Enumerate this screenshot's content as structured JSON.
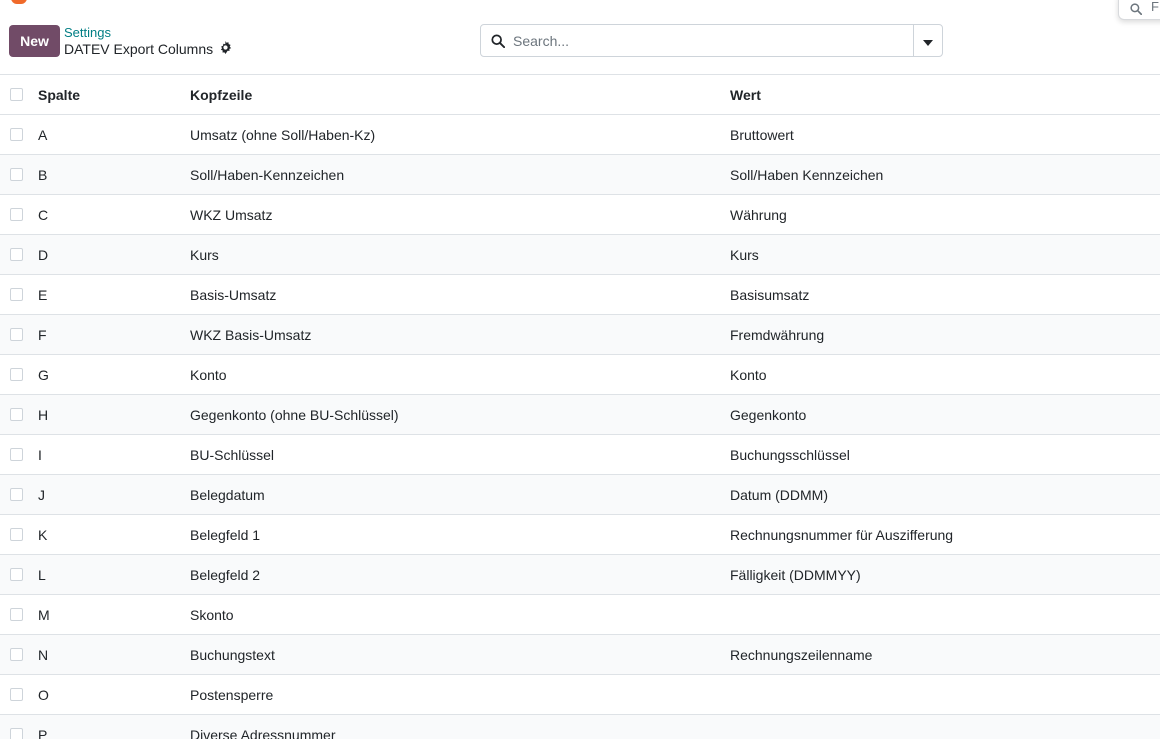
{
  "popover": {
    "text": "F"
  },
  "control_panel": {
    "new_label": "New",
    "breadcrumb_parent": "Settings",
    "breadcrumb_current": "DATEV Export Columns",
    "search_placeholder": "Search..."
  },
  "table": {
    "headers": {
      "spalte": "Spalte",
      "kopfzeile": "Kopfzeile",
      "wert": "Wert"
    },
    "rows": [
      {
        "spalte": "A",
        "kopfzeile": "Umsatz (ohne Soll/Haben-Kz)",
        "wert": "Bruttowert"
      },
      {
        "spalte": "B",
        "kopfzeile": "Soll/Haben-Kennzeichen",
        "wert": "Soll/Haben Kennzeichen"
      },
      {
        "spalte": "C",
        "kopfzeile": "WKZ Umsatz",
        "wert": "Währung"
      },
      {
        "spalte": "D",
        "kopfzeile": "Kurs",
        "wert": "Kurs"
      },
      {
        "spalte": "E",
        "kopfzeile": "Basis-Umsatz",
        "wert": "Basisumsatz"
      },
      {
        "spalte": "F",
        "kopfzeile": "WKZ Basis-Umsatz",
        "wert": "Fremdwährung"
      },
      {
        "spalte": "G",
        "kopfzeile": "Konto",
        "wert": "Konto"
      },
      {
        "spalte": "H",
        "kopfzeile": "Gegenkonto (ohne BU-Schlüssel)",
        "wert": "Gegenkonto"
      },
      {
        "spalte": "I",
        "kopfzeile": "BU-Schlüssel",
        "wert": "Buchungsschlüssel"
      },
      {
        "spalte": "J",
        "kopfzeile": "Belegdatum",
        "wert": "Datum (DDMM)"
      },
      {
        "spalte": "K",
        "kopfzeile": "Belegfeld 1",
        "wert": "Rechnungsnummer für Auszifferung"
      },
      {
        "spalte": "L",
        "kopfzeile": "Belegfeld 2",
        "wert": "Fälligkeit (DDMMYY)"
      },
      {
        "spalte": "M",
        "kopfzeile": "Skonto",
        "wert": ""
      },
      {
        "spalte": "N",
        "kopfzeile": "Buchungstext",
        "wert": "Rechnungszeilenname"
      },
      {
        "spalte": "O",
        "kopfzeile": "Postensperre",
        "wert": ""
      },
      {
        "spalte": "P",
        "kopfzeile": "Diverse Adressnummer",
        "wert": ""
      }
    ]
  },
  "colors": {
    "primary": "#714b67",
    "link": "#017e84",
    "border": "#dee2e6",
    "accent_logo": "#f06a2a"
  },
  "icons": {
    "search": "search-icon",
    "settings": "gear-icon",
    "toggle": "caret-down-icon"
  }
}
